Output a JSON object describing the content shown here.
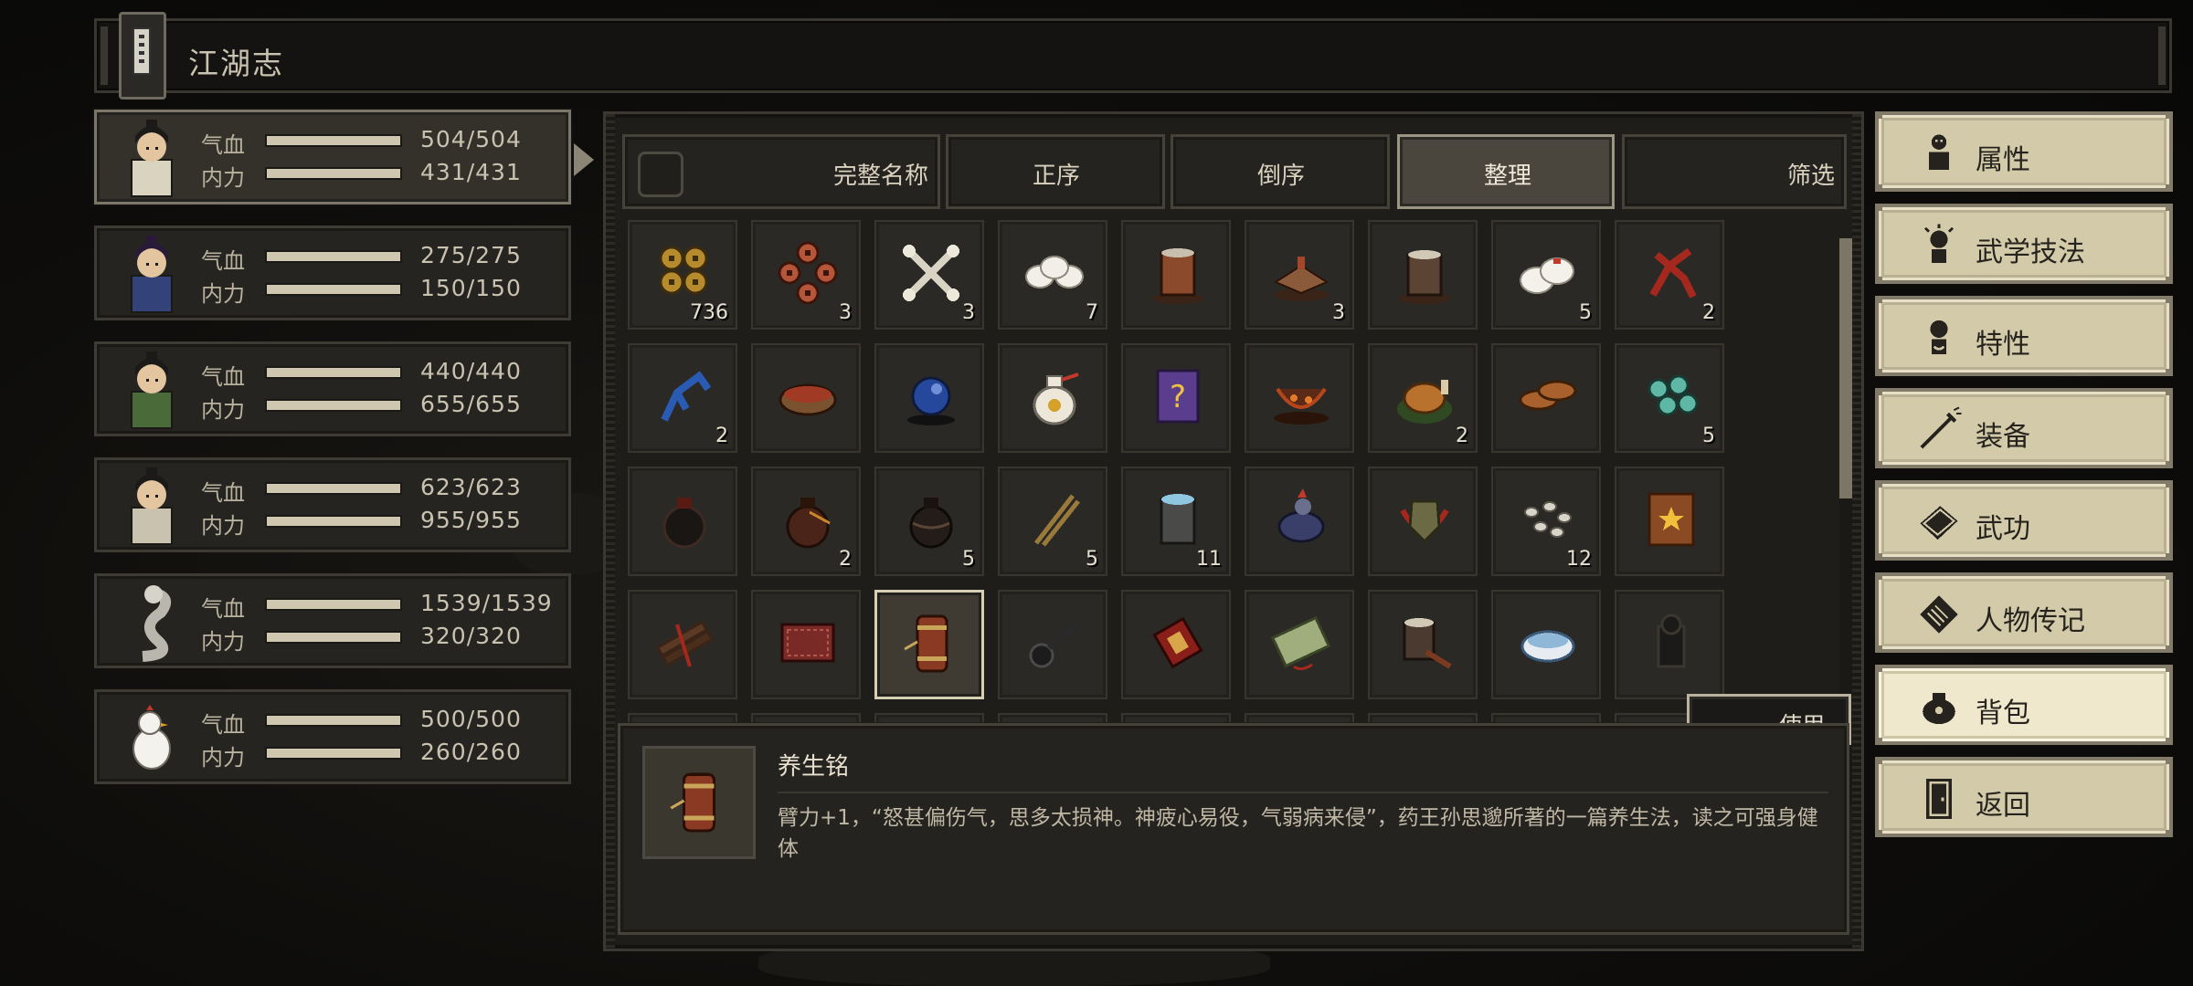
{
  "title": "江湖志",
  "party": [
    {
      "hp_label": "气血",
      "hp": "504/504",
      "hp_pct": 1.0,
      "mp_label": "内力",
      "mp": "431/431",
      "mp_pct": 1.0,
      "active": true
    },
    {
      "hp_label": "气血",
      "hp": "275/275",
      "hp_pct": 1.0,
      "mp_label": "内力",
      "mp": "150/150",
      "mp_pct": 1.0,
      "active": false
    },
    {
      "hp_label": "气血",
      "hp": "440/440",
      "hp_pct": 1.0,
      "mp_label": "内力",
      "mp": "655/655",
      "mp_pct": 1.0,
      "active": false
    },
    {
      "hp_label": "气血",
      "hp": "623/623",
      "hp_pct": 1.0,
      "mp_label": "内力",
      "mp": "955/955",
      "mp_pct": 1.0,
      "active": false
    },
    {
      "hp_label": "气血",
      "hp": "1539/1539",
      "hp_pct": 1.0,
      "mp_label": "内力",
      "mp": "320/320",
      "mp_pct": 1.0,
      "active": false
    },
    {
      "hp_label": "气血",
      "hp": "500/500",
      "hp_pct": 1.0,
      "mp_label": "内力",
      "mp": "260/260",
      "mp_pct": 1.0,
      "active": false
    }
  ],
  "sort_tabs": [
    {
      "label": "完整名称",
      "active": false
    },
    {
      "label": "正序",
      "active": false
    },
    {
      "label": "倒序",
      "active": false
    },
    {
      "label": "整理",
      "active": true
    },
    {
      "label": "筛选",
      "active": false
    }
  ],
  "inventory": [
    {
      "icon": "gold-coins-icon",
      "qty": "736"
    },
    {
      "icon": "copper-coins-icon",
      "qty": "3"
    },
    {
      "icon": "bones-icon",
      "qty": "3"
    },
    {
      "icon": "steamed-buns-icon",
      "qty": "7"
    },
    {
      "icon": "wine-cup-icon",
      "qty": ""
    },
    {
      "icon": "cake-slice-icon",
      "qty": "3"
    },
    {
      "icon": "tea-cup-icon",
      "qty": ""
    },
    {
      "icon": "rice-dumpling-icon",
      "qty": "5"
    },
    {
      "icon": "red-herb-icon",
      "qty": "2"
    },
    {
      "icon": "blue-herb-icon",
      "qty": "2"
    },
    {
      "icon": "soup-bowl-icon",
      "qty": ""
    },
    {
      "icon": "blue-orb-icon",
      "qty": ""
    },
    {
      "icon": "medicine-pouch-icon",
      "qty": ""
    },
    {
      "icon": "mystery-book-icon",
      "qty": ""
    },
    {
      "icon": "fire-dish-icon",
      "qty": ""
    },
    {
      "icon": "roast-chicken-icon",
      "qty": "2"
    },
    {
      "icon": "roast-meat-icon",
      "qty": ""
    },
    {
      "icon": "jade-stones-icon",
      "qty": "5"
    },
    {
      "icon": "black-jar-icon",
      "qty": ""
    },
    {
      "icon": "wine-jar-icon",
      "qty": "2"
    },
    {
      "icon": "dark-jar-icon",
      "qty": "5"
    },
    {
      "icon": "chopsticks-icon",
      "qty": "5"
    },
    {
      "icon": "water-bucket-icon",
      "qty": "11"
    },
    {
      "icon": "rooster-icon",
      "qty": ""
    },
    {
      "icon": "shield-amulet-icon",
      "qty": ""
    },
    {
      "icon": "pebbles-icon",
      "qty": "12"
    },
    {
      "icon": "star-scroll-icon",
      "qty": ""
    },
    {
      "icon": "wood-bundle-icon",
      "qty": ""
    },
    {
      "icon": "red-cloth-icon",
      "qty": ""
    },
    {
      "icon": "scroll-tube-icon",
      "qty": "",
      "selected": true
    },
    {
      "icon": "iron-key-icon",
      "qty": ""
    },
    {
      "icon": "red-scroll-icon",
      "qty": ""
    },
    {
      "icon": "green-banknote-icon",
      "qty": ""
    },
    {
      "icon": "drum-stick-icon",
      "qty": ""
    },
    {
      "icon": "porcelain-bowl-icon",
      "qty": ""
    },
    {
      "icon": "black-statue-icon",
      "qty": ""
    }
  ],
  "use_label": "使用",
  "selected_item": {
    "icon": "scroll-tube-icon",
    "name": "养生铭",
    "description": "臂力+1，“怒甚偏伤气，思多太损神。神疲心易役，气弱病来侵”，药王孙思邈所著的一篇养生法，读之可强身健体"
  },
  "menu": [
    {
      "label": "属性",
      "icon": "attributes-icon",
      "active": false
    },
    {
      "label": "武学技法",
      "icon": "martial-skills-icon",
      "active": false
    },
    {
      "label": "特性",
      "icon": "traits-icon",
      "active": false
    },
    {
      "label": "装备",
      "icon": "equipment-icon",
      "active": false
    },
    {
      "label": "武功",
      "icon": "kungfu-book-icon",
      "active": false
    },
    {
      "label": "人物传记",
      "icon": "biography-icon",
      "active": false
    },
    {
      "label": "背包",
      "icon": "bag-icon",
      "active": true
    },
    {
      "label": "返回",
      "icon": "door-exit-icon",
      "active": false
    }
  ],
  "colors": {
    "panel": "#1f1d1a",
    "accent": "#d2caa8",
    "text": "#d8d0bd"
  }
}
